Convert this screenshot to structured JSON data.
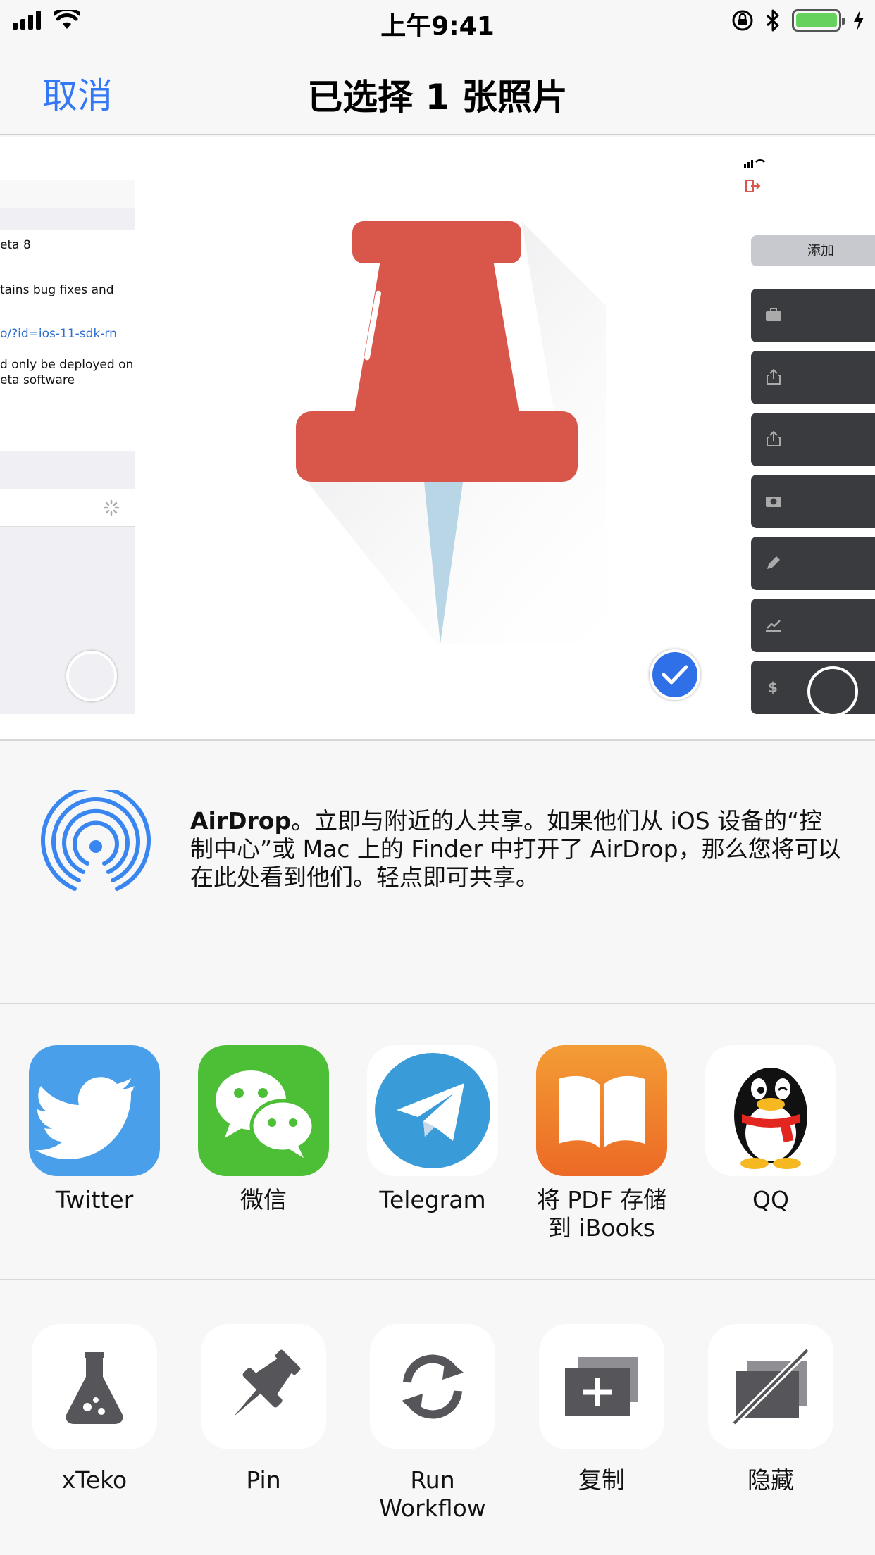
{
  "status_bar": {
    "time": "上午9:41"
  },
  "nav": {
    "cancel": "取消",
    "title": "已选择 1 张照片"
  },
  "preview": {
    "left_thumb": {
      "line1": "eta 8",
      "line2": "tains bug fixes and",
      "link": "o/?id=ios-11-sdk-rn",
      "line4": "d only be deployed on",
      "line5": "eta software"
    },
    "right_thumb": {
      "add_button": "添加"
    }
  },
  "airdrop": {
    "bold": "AirDrop",
    "text": "。立即与附近的人共享。如果他们从 iOS 设备的“控制中心”或 Mac 上的 Finder 中打开了 AirDrop，那么您将可以在此处看到他们。轻点即可共享。"
  },
  "apps": [
    {
      "label": "Twitter",
      "icon": "twitter-icon",
      "color": "#4a9fea"
    },
    {
      "label": "微信",
      "icon": "wechat-icon",
      "color": "#4cbf37"
    },
    {
      "label": "Telegram",
      "icon": "telegram-icon",
      "color": "#3a9bd9"
    },
    {
      "label": "将 PDF 存储\n到 iBooks",
      "icon": "ibooks-icon",
      "color": "#f07c1e"
    },
    {
      "label": "QQ",
      "icon": "qq-icon",
      "color": "#ffffff"
    }
  ],
  "actions": [
    {
      "label": "xTeko",
      "icon": "flask-icon"
    },
    {
      "label": "Pin",
      "icon": "pin-icon"
    },
    {
      "label": "Run\nWorkflow",
      "icon": "refresh-icon"
    },
    {
      "label": "复制",
      "icon": "duplicate-icon"
    },
    {
      "label": "隐藏",
      "icon": "hide-icon"
    }
  ],
  "colors": {
    "accent": "#3478f6",
    "pin_red": "#d9564a",
    "battery_green": "#66d15c"
  }
}
